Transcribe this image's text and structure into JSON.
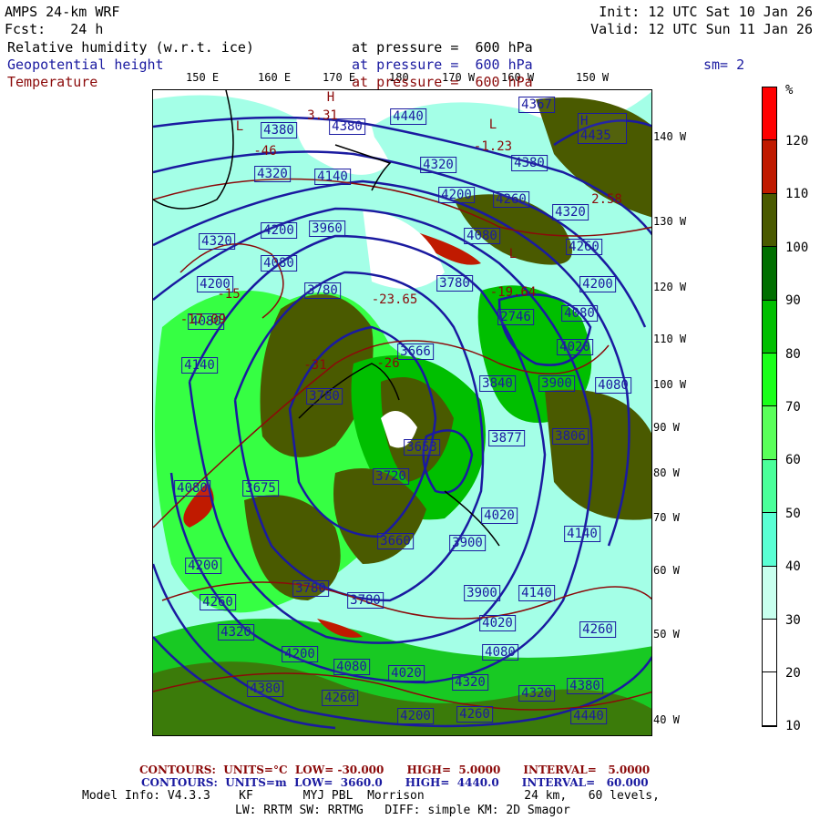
{
  "header": {
    "title": "AMPS 24-km WRF",
    "forecast": "Fcst:   24 h",
    "init": "Init: 12 UTC Sat 10 Jan 26",
    "valid": "Valid: 12 UTC Sun 11 Jan 26",
    "fields": [
      {
        "name": "Relative humidity (w.r.t. ice)",
        "level": "at pressure =  600 hPa",
        "color": "#000000"
      },
      {
        "name": "Geopotential height",
        "level": "at pressure =  600 hPa",
        "color": "#1a1aa0"
      },
      {
        "name": "Temperature",
        "level": "at pressure =  600 hPa",
        "color": "#8b0a0a"
      }
    ],
    "smoothing": "sm= 2"
  },
  "map": {
    "lon_labels": [
      "150 E",
      "160 E",
      "170 E",
      "180",
      "170 W",
      "160 W",
      "150 W"
    ],
    "lat_labels": [
      "140 W",
      "130 W",
      "120 W",
      "110 W",
      "100 W",
      "90 W",
      "80 W",
      "70 W",
      "60 W",
      "50 W",
      "40 W"
    ],
    "height_labels": [
      "4380",
      "4380",
      "4440",
      "4320",
      "4140",
      "4320",
      "4380",
      "4200",
      "4260",
      "4320",
      "4367",
      "H 4435",
      "4200",
      "3960",
      "4320",
      "4080",
      "3780",
      "4200",
      "4080",
      "4260",
      "4200",
      "3780",
      "4080",
      "2746",
      "4080",
      "4020",
      "3666",
      "4140",
      "3840",
      "3900",
      "4080",
      "3780",
      "3653",
      "3720",
      "4080",
      "3675",
      "3877",
      "3806",
      "4020",
      "3660",
      "3900",
      "4140",
      "4200",
      "4260",
      "3780",
      "3780",
      "3900",
      "4140",
      "4020",
      "4260",
      "4320",
      "4200",
      "4080",
      "4020",
      "4080",
      "4320",
      "4320",
      "4380",
      "4260",
      "4380",
      "4200",
      "4260",
      "4440"
    ],
    "temp_labels": [
      "-46",
      "3.31",
      "-1.23",
      "2.58",
      "-19.64",
      "-23.65",
      "-15",
      "-31",
      "-26",
      "-17.09",
      "H",
      "L",
      "L",
      "L"
    ]
  },
  "colorbar": {
    "unit": "%",
    "labels": [
      "120",
      "110",
      "100",
      "90",
      "80",
      "70",
      "60",
      "50",
      "40",
      "30",
      "20",
      "10"
    ],
    "colors": [
      "#ff0000",
      "#c01a00",
      "#4a5a00",
      "#006f00",
      "#00bf00",
      "#1aff1a",
      "#5aff5a",
      "#4aff9a",
      "#5affd4",
      "#c8ffee",
      "#ffffff",
      "#ffffff"
    ]
  },
  "footer": {
    "temp_contours": {
      "label": "CONTOURS:",
      "units": "UNITS=°C",
      "low": "LOW= -30.000",
      "high": "HIGH=  5.0000",
      "interval": "INTERVAL=   5.0000",
      "color": "#8b0a0a"
    },
    "height_contours": {
      "label": "CONTOURS:",
      "units": "UNITS=m",
      "low": "LOW=  3660.0",
      "high": "HIGH=  4440.0",
      "interval": "INTERVAL=   60.000",
      "color": "#1a1aa0"
    },
    "model_info": "Model Info: V4.3.3    KF       MYJ PBL  Morrison              24 km,   60 levels,",
    "physics": "LW: RRTM SW: RRTMG   DIFF: simple KM: 2D Smagor"
  }
}
